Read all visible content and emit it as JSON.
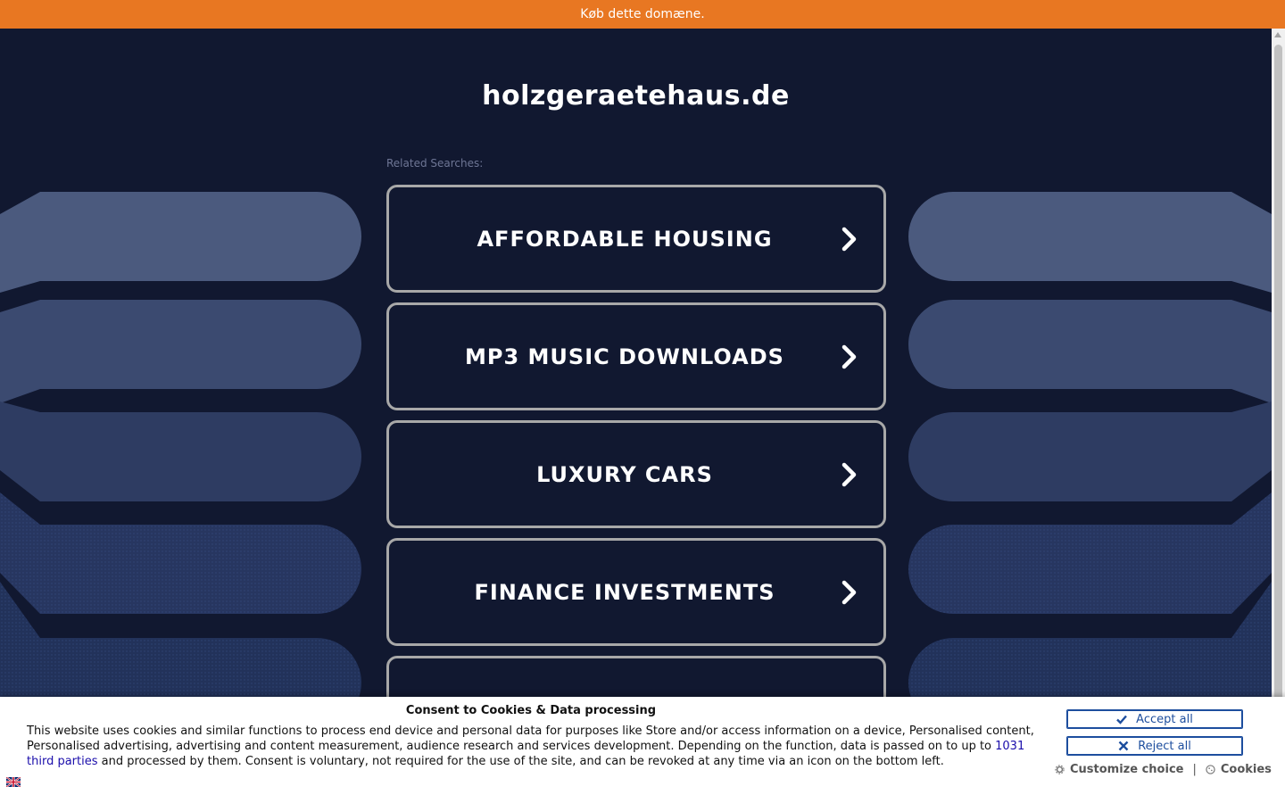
{
  "topbar": {
    "text": "Køb dette domæne."
  },
  "header": {
    "domain": "holzgeraetehaus.de"
  },
  "related": {
    "label": "Related Searches:"
  },
  "searches": [
    {
      "label": "AFFORDABLE HOUSING"
    },
    {
      "label": "MP3 MUSIC DOWNLOADS"
    },
    {
      "label": "LUXURY CARS"
    },
    {
      "label": "FINANCE INVESTMENTS"
    },
    {
      "label": ""
    }
  ],
  "consent": {
    "title": "Consent to Cookies & Data processing",
    "text_before": "This website uses cookies and similar functions to process end device and personal data for purposes like Store and/or access information on a device, Personalised content, Personalised advertising, advertising and content measurement, audience research and services development. Depending on the function, data is passed on to up to ",
    "link_text": "1031 third parties",
    "text_after": " and processed by them. Consent is voluntary, not required for the use of the site, and can be revoked at any time via an icon on the bottom left.",
    "accept_label": "Accept all",
    "reject_label": "Reject all",
    "customize_label": "Customize choice",
    "separator": "|",
    "cookies_label": "Cookies"
  },
  "colors": {
    "topbar": "#e87722",
    "background": "#111830",
    "button_border": "#a8a8a8",
    "consent_accent": "#1d4e9e"
  },
  "icons": {
    "chevron": "chevron-right-icon",
    "accept": "check-icon",
    "reject": "close-icon",
    "customize": "gear-icon",
    "cookies": "cookie-icon",
    "language": "uk-flag-icon"
  }
}
